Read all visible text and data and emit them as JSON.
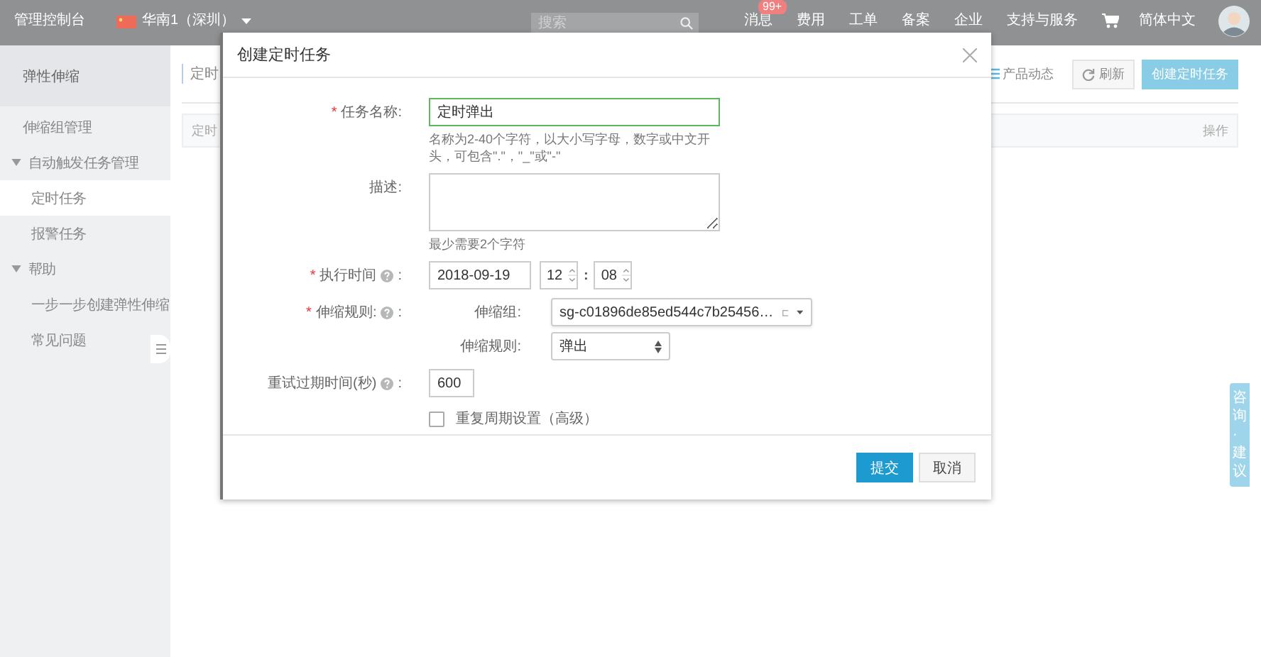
{
  "topbar": {
    "brand": "管理控制台",
    "region": "华南1（深圳）",
    "search": {
      "placeholder": "搜索"
    },
    "nav": [
      {
        "label": "消息",
        "badge": "99+"
      },
      {
        "label": "费用"
      },
      {
        "label": "工单"
      },
      {
        "label": "备案"
      },
      {
        "label": "企业"
      },
      {
        "label": "支持与服务"
      }
    ],
    "language": "简体中文"
  },
  "sidebar": {
    "title": "弹性伸缩",
    "items": [
      {
        "label": "伸缩组管理",
        "selected": false
      },
      {
        "label": "自动触发任务管理",
        "selected": false,
        "expanded": true,
        "children": [
          {
            "label": "定时任务",
            "selected": true
          },
          {
            "label": "报警任务",
            "selected": false
          }
        ]
      },
      {
        "label": "帮助",
        "selected": false,
        "expanded": true,
        "children": [
          {
            "label": "一步一步创建弹性伸缩",
            "selected": false
          },
          {
            "label": "常见问题",
            "selected": false
          }
        ]
      }
    ]
  },
  "page": {
    "title": "定时",
    "links": [
      {
        "label": "产品动态"
      }
    ],
    "buttons": [
      {
        "label": "刷新",
        "kind": "default"
      },
      {
        "label": "创建定时任务",
        "kind": "primary"
      }
    ],
    "table": {
      "columns": [
        "定时",
        "操作"
      ]
    }
  },
  "dialog": {
    "title": "创建定时任务",
    "fields": [
      {
        "kind": "text",
        "required_mark": "*",
        "label": "任务名称:",
        "value": "定时弹出",
        "valid": true,
        "hint": "名称为2-40个字符，以大小写字母，数字或中文开头，可包含\".\"，\"_\"或\"-\""
      },
      {
        "kind": "textarea",
        "label": "描述:",
        "hint": "最少需要2个字符"
      },
      {
        "kind": "datetime",
        "required_mark": "*",
        "label": "执行时间",
        "help": true,
        "suffix": ":",
        "date": "2018-09-19",
        "hour": "12",
        "separator": ":",
        "minute": "08"
      },
      {
        "kind": "rule",
        "required_mark": "*",
        "label": "伸缩规则:",
        "help": true,
        "suffix": ":",
        "subfields": [
          {
            "kind": "combo",
            "label": "伸缩组:",
            "value": "sg-c01896de85ed544c7b25456…"
          },
          {
            "kind": "select",
            "label": "伸缩规则:",
            "value": "弹出"
          }
        ]
      },
      {
        "kind": "number",
        "label": "重试过期时间(秒)",
        "help": true,
        "suffix": ":",
        "value": "600"
      },
      {
        "kind": "checkbox",
        "label": "重复周期设置（高级）",
        "checked": false
      }
    ],
    "buttons": [
      {
        "label": "提交",
        "kind": "primary"
      },
      {
        "label": "取消",
        "kind": "default"
      }
    ]
  },
  "floating_tab": {
    "label": "咨询·建议"
  }
}
